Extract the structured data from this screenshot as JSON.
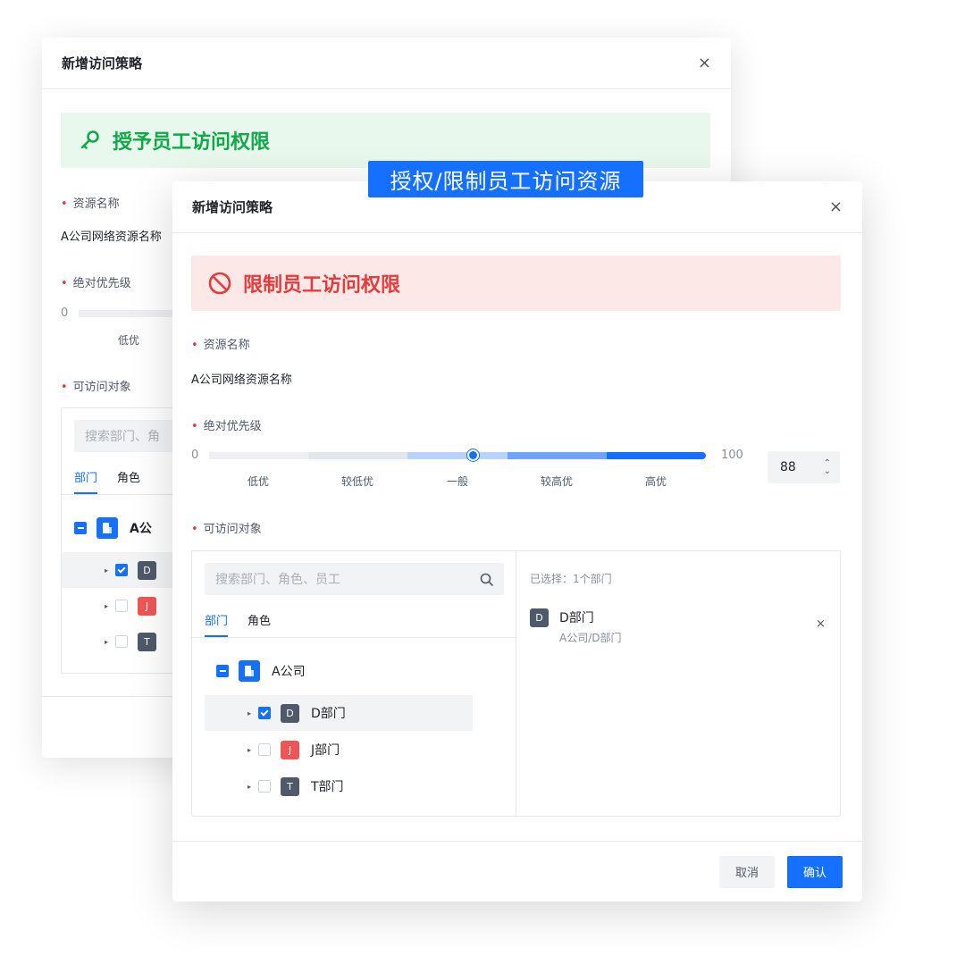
{
  "overlay_tag": "授权/限制员工访问资源",
  "back_dialog": {
    "title": "新增访问策略",
    "close": "×",
    "banner": "授予员工访问权限",
    "resource_label": "资源名称",
    "resource_value": "A公司网络资源名称",
    "priority_label": "绝对优先级",
    "slider_min": "0",
    "level_first": "低优",
    "objects_label": "可访问对象",
    "search_placeholder": "搜索部门、角",
    "tabs": [
      "部门",
      "角色"
    ],
    "tree_root": "A公",
    "tree_items": [
      {
        "avatar": "D"
      },
      {
        "avatar": "J"
      },
      {
        "avatar": "T"
      }
    ]
  },
  "front_dialog": {
    "title": "新增访问策略",
    "close": "×",
    "banner": "限制员工访问权限",
    "resource_label": "资源名称",
    "resource_value": "A公司网络资源名称",
    "priority_label": "绝对优先级",
    "slider_min": "0",
    "slider_max": "100",
    "slider_value": 88,
    "levels": [
      "低优",
      "较低优",
      "一般",
      "较高优",
      "高优"
    ],
    "stepper_value": "88",
    "objects_label": "可访问对象",
    "search_placeholder": "搜索部门、角色、员工",
    "tabs": [
      "部门",
      "角色"
    ],
    "tree_root": "A公司",
    "tree_items": [
      {
        "avatar": "D",
        "label": "D部门",
        "checked": true
      },
      {
        "avatar": "J",
        "label": "J部门",
        "checked": false
      },
      {
        "avatar": "T",
        "label": "T部门",
        "checked": false
      }
    ],
    "selected_summary": "已选择：1个部门",
    "selected_item": {
      "avatar": "D",
      "name": "D部门",
      "path": "A公司/D部门",
      "remove": "×"
    },
    "cancel_label": "取消",
    "ok_label": "确认"
  },
  "colors": {
    "primary": "#1670ff",
    "grant_green": "#11a84a",
    "restrict_red": "#e23c3c",
    "avatar_gray": "#4e5969",
    "avatar_red": "#f05555"
  }
}
